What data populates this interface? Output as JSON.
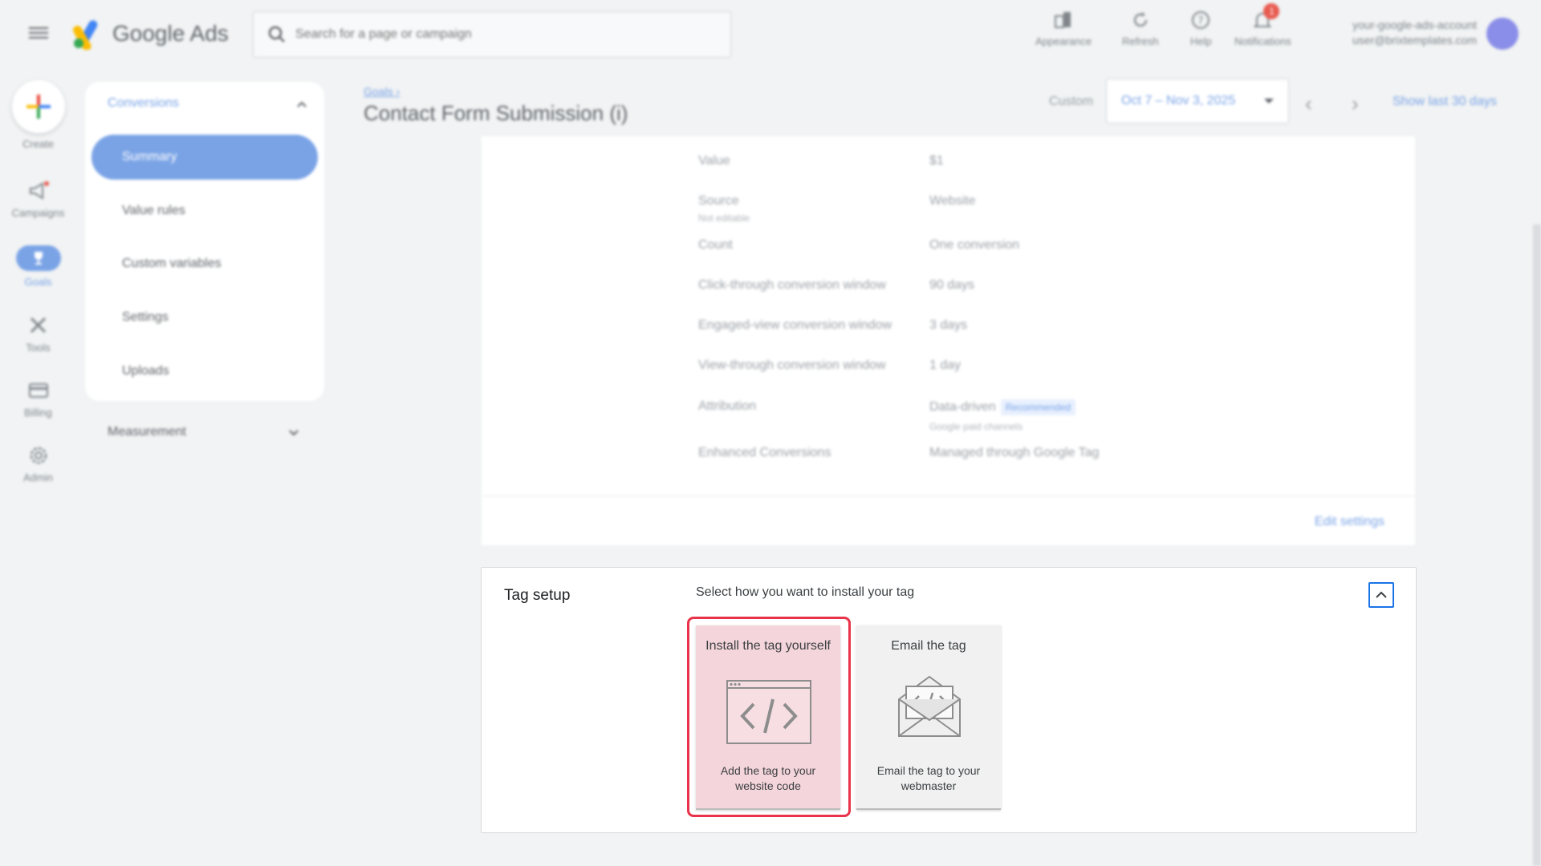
{
  "header": {
    "app_name": "Google Ads",
    "search_placeholder": "Search for a page or campaign",
    "actions": [
      {
        "label": "Appearance",
        "icon": "appearance-icon"
      },
      {
        "label": "Refresh",
        "icon": "refresh-icon"
      },
      {
        "label": "Help",
        "icon": "help-icon"
      },
      {
        "label": "Notifications",
        "icon": "bell-icon",
        "badge": "1"
      }
    ],
    "account_name": "your-google-ads-account",
    "account_email": "user@brixtemplates.com"
  },
  "rail": {
    "items": [
      {
        "label": "Create",
        "icon": "plus-icon"
      },
      {
        "label": "Campaigns",
        "icon": "megaphone-icon"
      },
      {
        "label": "Goals",
        "icon": "trophy-icon"
      },
      {
        "label": "Tools",
        "icon": "tools-icon"
      },
      {
        "label": "Billing",
        "icon": "credit-card-icon"
      },
      {
        "label": "Admin",
        "icon": "gear-icon"
      }
    ]
  },
  "sidenav": {
    "section": "Conversions",
    "items": [
      "Summary",
      "Value rules",
      "Custom variables",
      "Settings",
      "Uploads"
    ],
    "active": "Summary",
    "measurement": "Measurement"
  },
  "page": {
    "breadcrumb": "Goals",
    "title": "Contact Form Submission (i)",
    "date_label": "Custom",
    "date_range": "Oct 7 – Nov 3, 2025",
    "show_last": "Show last 30 days"
  },
  "settings": {
    "rows": [
      {
        "label": "Value",
        "value": "$1"
      },
      {
        "label": "Source",
        "sub": "Not editable",
        "value": "Website"
      },
      {
        "label": "Count",
        "value": "One conversion"
      },
      {
        "label": "Click-through conversion window",
        "value": "90 days"
      },
      {
        "label": "Engaged-view conversion window",
        "value": "3 days"
      },
      {
        "label": "View-through conversion window",
        "value": "1 day"
      },
      {
        "label": "Attribution",
        "value": "Data-driven",
        "badge": "Recommended",
        "value_sub": "Google paid channels"
      },
      {
        "label": "Enhanced Conversions",
        "value": "Managed through Google Tag"
      }
    ],
    "edit_label": "Edit settings"
  },
  "tag_setup": {
    "title": "Tag setup",
    "subtitle": "Select how you want to install your tag",
    "options": [
      {
        "title": "Install the tag yourself",
        "desc": "Add the tag to your website code",
        "icon": "code-window-icon",
        "selected": true
      },
      {
        "title": "Email the tag",
        "desc": "Email the tag to your webmaster",
        "icon": "email-code-icon",
        "selected": false
      }
    ]
  },
  "colors": {
    "accent": "#1a73e8",
    "highlight": "#e8334a",
    "selected_option": "#f4d5db"
  }
}
